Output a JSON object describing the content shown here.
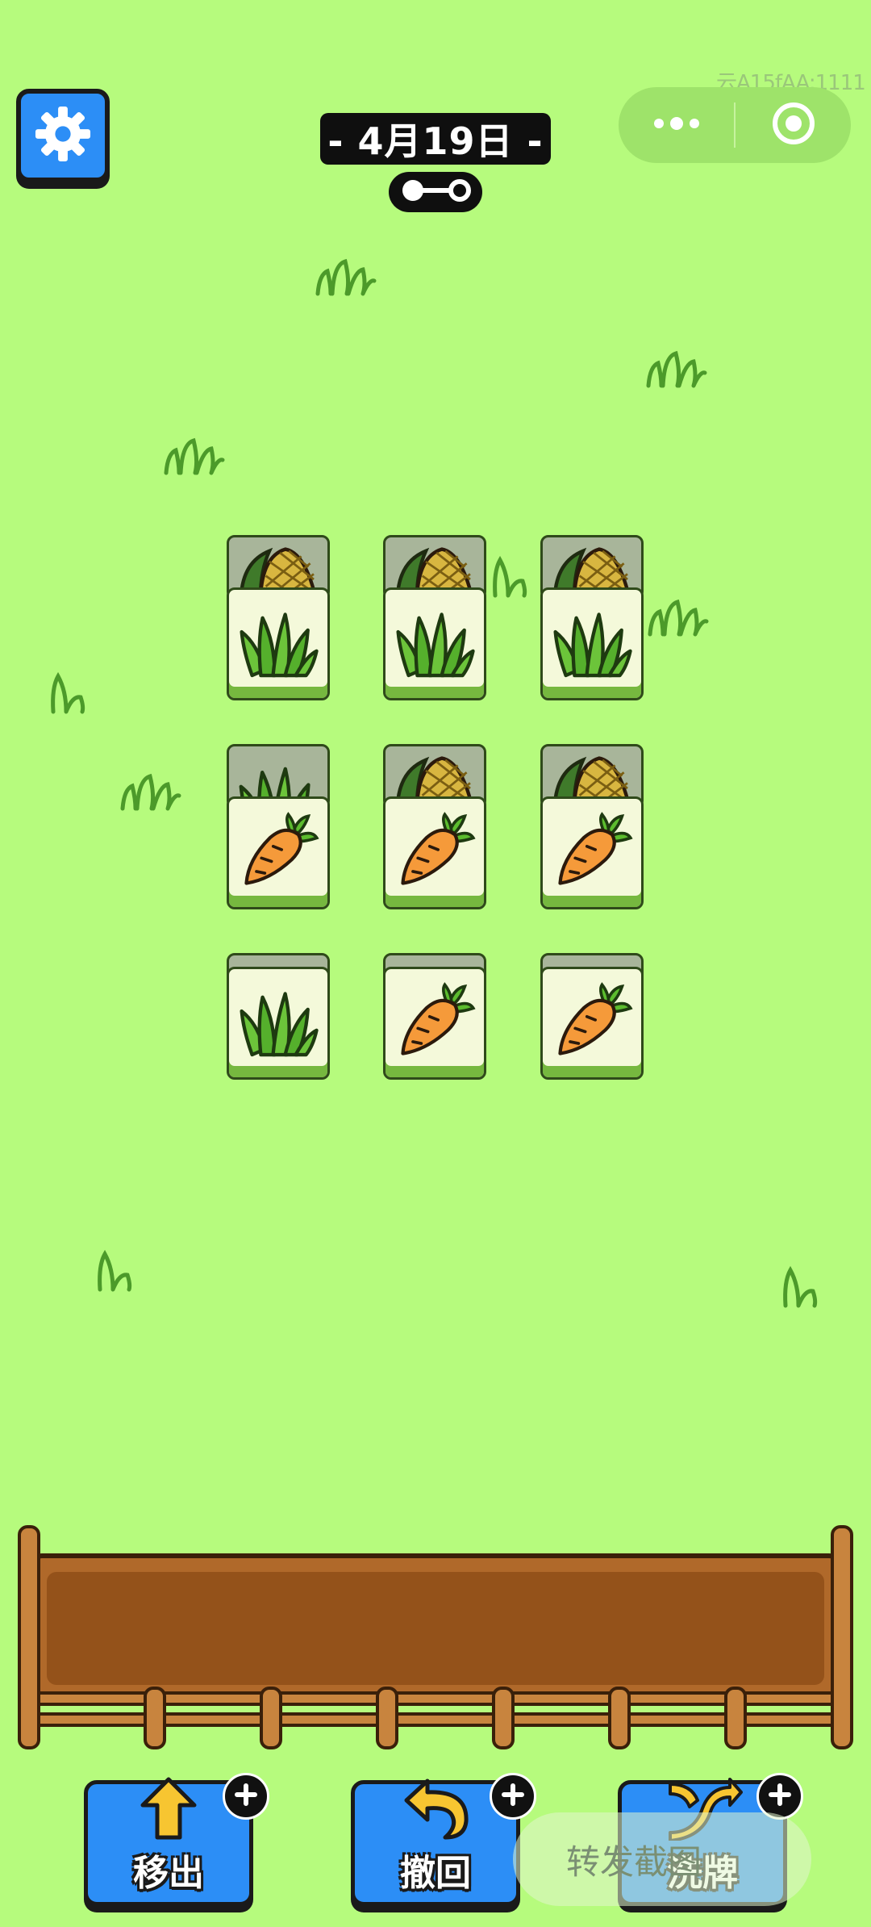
{
  "header": {
    "date_label": "- 4月19日 -",
    "watermark": "云A15fAA:1111"
  },
  "icons": {
    "settings": "gear-icon",
    "key": "key-icon",
    "more": "more-dots-icon",
    "close": "target-icon"
  },
  "board": {
    "rows": [
      {
        "top": [
          "corn",
          "corn",
          "corn"
        ],
        "front": [
          "grass",
          "grass",
          "grass"
        ]
      },
      {
        "top": [
          "grass",
          "corn",
          "corn"
        ],
        "front": [
          "carrot",
          "carrot",
          "carrot"
        ]
      },
      {
        "top": [
          "",
          "",
          ""
        ],
        "front": [
          "grass",
          "carrot",
          "carrot"
        ]
      }
    ]
  },
  "tray": {
    "slots_filled": 0
  },
  "actions": [
    {
      "id": "remove",
      "label": "移出",
      "icon": "arrow-out-icon"
    },
    {
      "id": "undo",
      "label": "撤回",
      "icon": "undo-arrow-icon"
    },
    {
      "id": "shuffle",
      "label": "洗牌",
      "icon": "shuffle-icon"
    }
  ],
  "overlay": {
    "share_label": "转发截图"
  },
  "colors": {
    "background": "#b6fb7d",
    "button_blue": "#2c8ef6",
    "tray_brown": "#9a5a1c"
  }
}
